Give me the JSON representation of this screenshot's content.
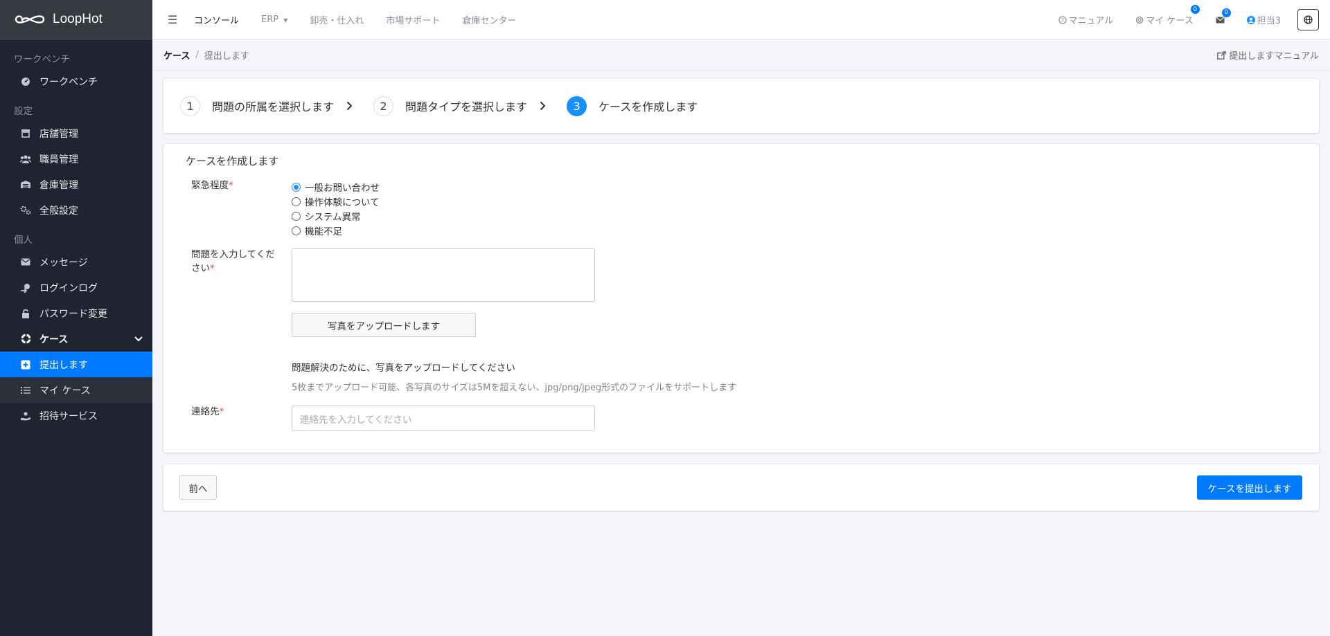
{
  "brand": {
    "name": "LoopHot"
  },
  "sidebar": {
    "sections": [
      {
        "header": "ワークベンチ",
        "items": [
          {
            "label": "ワークベンチ",
            "icon": "dashboard-icon"
          }
        ]
      },
      {
        "header": "設定",
        "items": [
          {
            "label": "店舗管理",
            "icon": "store-icon"
          },
          {
            "label": "職員管理",
            "icon": "users-icon"
          },
          {
            "label": "倉庫管理",
            "icon": "warehouse-icon"
          },
          {
            "label": "全般設定",
            "icon": "gears-icon"
          }
        ]
      },
      {
        "header": "個人",
        "items": [
          {
            "label": "メッセージ",
            "icon": "envelope-icon"
          },
          {
            "label": "ログインログ",
            "icon": "login-log-icon"
          },
          {
            "label": "パスワード変更",
            "icon": "lock-icon"
          },
          {
            "label": "ケース",
            "icon": "lifebuoy-icon"
          },
          {
            "label": "提出します",
            "icon": "plus-square-icon"
          },
          {
            "label": "マイ ケース",
            "icon": "list-icon"
          },
          {
            "label": "招待サービス",
            "icon": "hand-holding-icon"
          }
        ]
      }
    ]
  },
  "topbar": {
    "nav": [
      "コンソール",
      "ERP",
      "卸売・仕入れ",
      "市場サポート",
      "倉庫センター"
    ],
    "manual": "マニュアル",
    "my_case": "マイ ケース",
    "my_case_badge": "0",
    "mail_badge": "0",
    "user": "担当3"
  },
  "breadcrumb": {
    "parent": "ケース",
    "separator": "/",
    "current": "提出します",
    "manual_link": "提出しますマニュアル"
  },
  "steps": [
    {
      "number": "1",
      "label": "問題の所属を選択します"
    },
    {
      "number": "2",
      "label": "問題タイプを選択します"
    },
    {
      "number": "3",
      "label": "ケースを作成します"
    }
  ],
  "form": {
    "title": "ケースを作成します",
    "urgency_label": "緊急程度",
    "required_mark": "*",
    "urgency_options": [
      "一般お問い合わせ",
      "操作体験について",
      "システム異常",
      "機能不足"
    ],
    "urgency_selected": "一般お問い合わせ",
    "problem_label_line1": "問題を入力してくだ",
    "problem_label_line2": "さい",
    "problem_value": "",
    "upload_button": "写真をアップロードします",
    "upload_hint": "問題解決のために、写真をアップロードしてください",
    "upload_limits": "5枚までアップロード可能、各写真のサイズは5Mを超えない、jpg/png/jpeg形式のファイルをサポートします",
    "contact_label": "連絡先",
    "contact_placeholder": "連絡先を入力してください"
  },
  "actions": {
    "prev": "前へ",
    "submit": "ケースを提出します"
  },
  "colors": {
    "accent": "#007bff",
    "sidebar_bg": "#1f2430",
    "step_active": "#1890ff",
    "required": "#e74c3c"
  }
}
